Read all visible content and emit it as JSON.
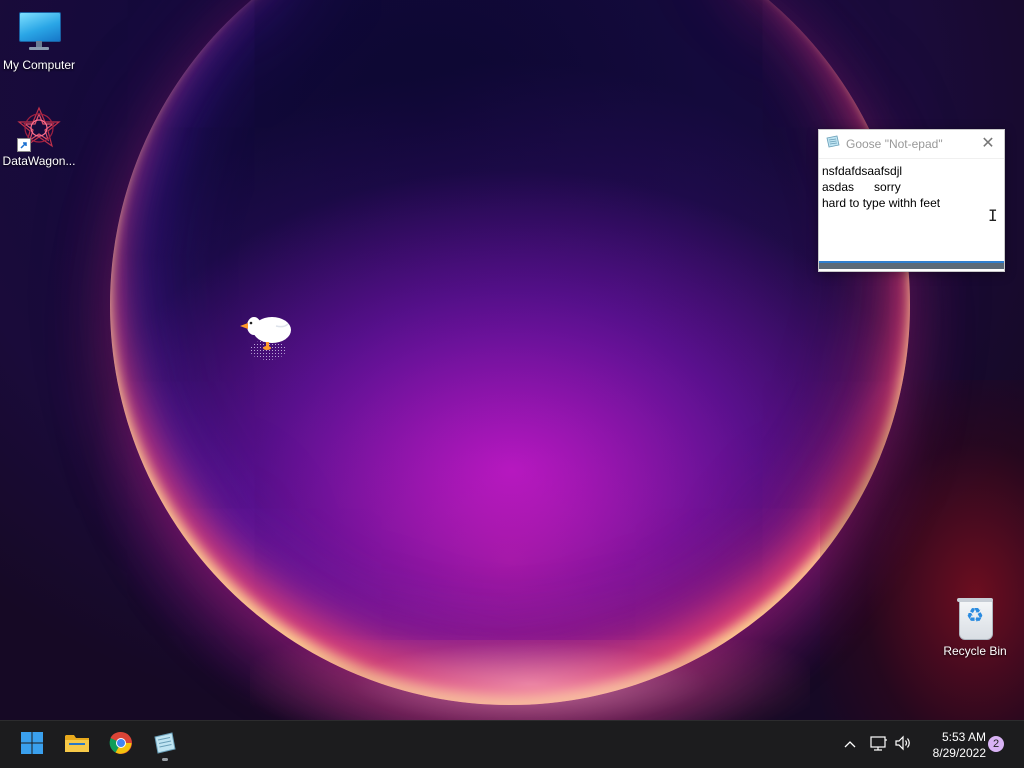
{
  "desktop": {
    "icons": [
      {
        "label": "My Computer",
        "icon": "monitor-icon"
      },
      {
        "label": "DataWagon...",
        "icon": "mandala-icon"
      },
      {
        "label": "Recycle Bin",
        "icon": "recycle-bin-icon"
      }
    ]
  },
  "notepad": {
    "title": "Goose \"Not-epad\"",
    "text": "nsfdafdsaafsdjl\nasdas      sorry\nhard to type withh feet\n            ",
    "close_icon": "close-icon"
  },
  "taskbar": {
    "apps": [
      {
        "name": "Start",
        "icon": "windows-start-icon"
      },
      {
        "name": "File Explorer",
        "icon": "folder-icon"
      },
      {
        "name": "Google Chrome",
        "icon": "chrome-icon"
      },
      {
        "name": "Goose Not-epad",
        "icon": "notepad-icon"
      }
    ],
    "tray": {
      "icons": [
        "chevron-up-icon",
        "network-icon",
        "volume-icon"
      ],
      "time": "5:53 AM",
      "date": "8/29/2022",
      "notification_count": "2"
    }
  },
  "colors": {
    "taskbar": "#1c1c1e",
    "accent": "#2f7fcf",
    "notification_badge": "#d9b3f5"
  }
}
